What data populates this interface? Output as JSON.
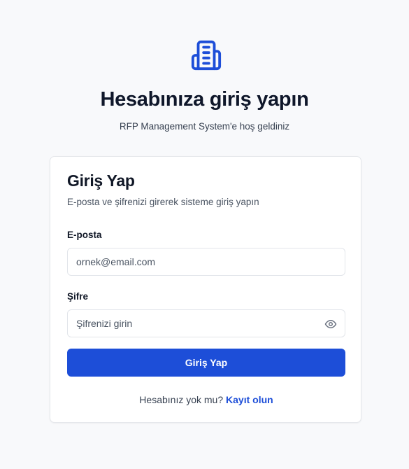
{
  "header": {
    "logo_icon": "building-icon",
    "title": "Hesabınıza giriş yapın",
    "subtitle": "RFP Management System'e hoş geldiniz"
  },
  "card": {
    "title": "Giriş Yap",
    "description": "E-posta ve şifrenizi girerek sisteme giriş yapın",
    "email": {
      "label": "E-posta",
      "placeholder": "ornek@email.com",
      "value": ""
    },
    "password": {
      "label": "Şifre",
      "placeholder": "Şifrenizi girin",
      "value": "",
      "toggle_icon": "eye-icon"
    },
    "submit_label": "Giriş Yap",
    "footer": {
      "text": "Hesabınız yok mu?",
      "link_label": "Kayıt olun"
    }
  },
  "colors": {
    "accent": "#1d4ed8",
    "page_background": "#f8f9fb",
    "card_background": "#ffffff",
    "border": "#e5e7eb"
  }
}
